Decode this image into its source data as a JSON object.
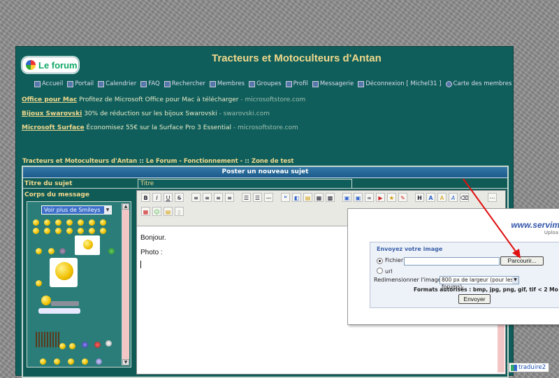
{
  "header": {
    "logo_text": "Le forum",
    "site_title": "Tracteurs et Motoculteurs d'Antan"
  },
  "nav": [
    {
      "label": "Accueil",
      "icon": "home-icon"
    },
    {
      "label": "Portail",
      "icon": "portal-icon"
    },
    {
      "label": "Calendrier",
      "icon": "calendar-icon"
    },
    {
      "label": "FAQ",
      "icon": "faq-icon"
    },
    {
      "label": "Rechercher",
      "icon": "search-icon"
    },
    {
      "label": "Membres",
      "icon": "members-icon"
    },
    {
      "label": "Groupes",
      "icon": "groups-icon"
    },
    {
      "label": "Profil",
      "icon": "profile-icon"
    },
    {
      "label": "Messagerie",
      "icon": "mail-icon"
    },
    {
      "label": "Déconnexion [ Michel31 ]",
      "icon": "logout-icon"
    },
    {
      "label": "Carte des membres",
      "icon": "globe-icon"
    }
  ],
  "ads": [
    {
      "link": "Office pour Mac",
      "text": " Profitez de Microsoft Office pour Mac à télécharger",
      "url": " - microsoftstore.com"
    },
    {
      "link": "Bijoux Swarovski",
      "text": " 30% de réduction sur les bijoux Swarovski",
      "url": " - swarovski.com"
    },
    {
      "link": "Microsoft Surface",
      "text": " Économisez 55€ sur la Surface Pro 3 Essential",
      "url": " - microsoftstore.com"
    }
  ],
  "breadcrumb": {
    "site": "Tracteurs et Motoculteurs d'Antan",
    "sep": " :: ",
    "forum": "Le Forum - Fonctionnement -",
    "sep2": " :: ",
    "section": "Zone de test"
  },
  "form": {
    "header": "Poster un nouveau sujet",
    "subject_label": "Titre du sujet",
    "subject_value": "Titre",
    "body_label": "Corps du message",
    "smileys_select": "Voir plus de Smileys",
    "body_lines": [
      "Bonjour.",
      "Photo :"
    ]
  },
  "toolbar": {
    "row1": [
      "B",
      "I",
      "U",
      "S"
    ]
  },
  "upload_popup": {
    "logo_a": "www.",
    "logo_b": "servim",
    "logo_sub": "Uploa",
    "title": "Envoyez votre image",
    "file_label": "Fichier",
    "browse_button": "Parcourir...",
    "url_label": "url",
    "resize_label": "Redimensionner l'image",
    "resize_value": "800 px de largeur (pour les forums)",
    "formats": "Formats autorisés : bmp, jpg, png, gif, tif < 2 Mo",
    "send_button": "Envoyer"
  },
  "translate_widget": {
    "label": "traduire2"
  },
  "colors": {
    "panel": "#0f5e5b",
    "gold": "#f2d98c",
    "arrow": "#e01010"
  }
}
